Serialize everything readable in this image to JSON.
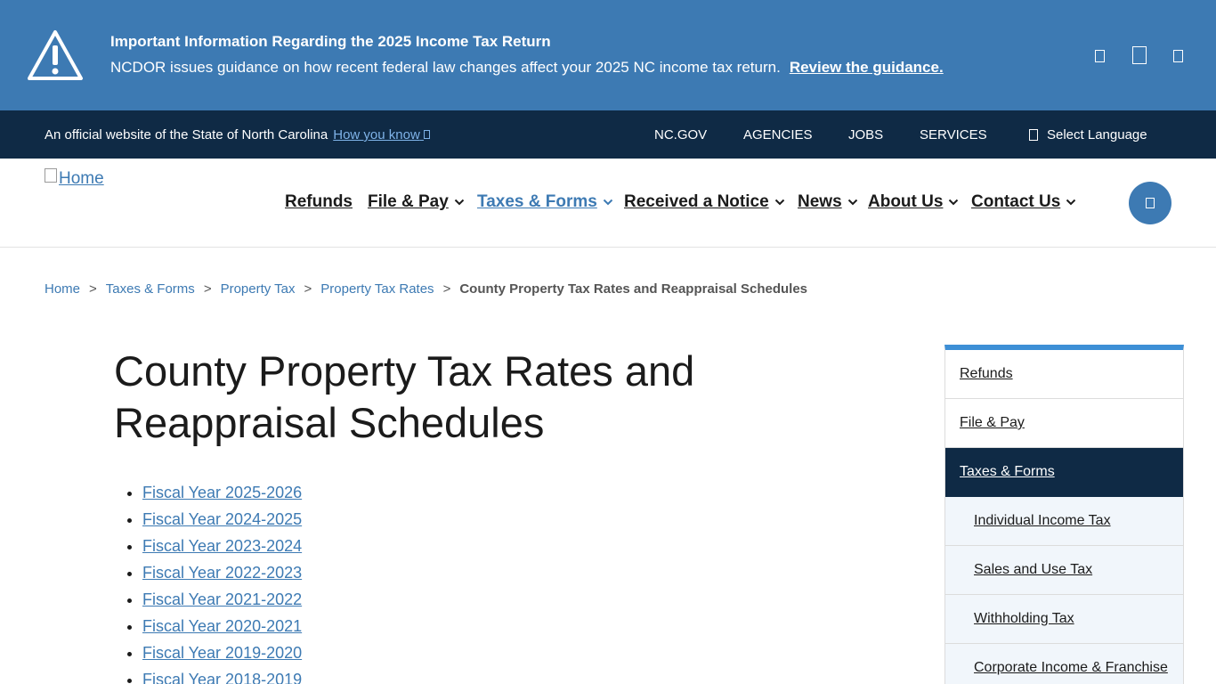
{
  "alert": {
    "title": "Important Information Regarding the 2025 Income Tax Return",
    "body": "NCDOR issues guidance on how recent federal law changes affect your 2025 NC income tax return.",
    "link": "Review the guidance.",
    "icon": "warning-triangle-icon",
    "controls": [
      "prev-icon",
      "pause-icon",
      "next-icon"
    ]
  },
  "official_bar": {
    "text": "An official website of the State of North Carolina",
    "how_link": "How you know",
    "utility_links": [
      "NC.GOV",
      "AGENCIES",
      "JOBS",
      "SERVICES"
    ],
    "language": "Select Language"
  },
  "header": {
    "logo_alt": "Home",
    "nav": [
      {
        "label": "Refunds",
        "dropdown": false,
        "active": false
      },
      {
        "label": "File & Pay",
        "dropdown": true,
        "active": false
      },
      {
        "label": "Taxes & Forms",
        "dropdown": true,
        "active": true
      },
      {
        "label": "Received a Notice",
        "dropdown": true,
        "active": false
      },
      {
        "label": "News",
        "dropdown": true,
        "active": false
      },
      {
        "label": "About Us",
        "dropdown": true,
        "active": false
      },
      {
        "label": "Contact Us",
        "dropdown": true,
        "active": false
      }
    ]
  },
  "breadcrumb": {
    "items": [
      "Home",
      "Taxes & Forms",
      "Property Tax",
      "Property Tax Rates"
    ],
    "separator": ">",
    "current": "County Property Tax Rates and Reappraisal Schedules"
  },
  "main": {
    "title": "County Property Tax Rates and Reappraisal Schedules",
    "fiscal_years": [
      "Fiscal Year 2025-2026",
      "Fiscal Year 2024-2025",
      "Fiscal Year 2023-2024",
      "Fiscal Year 2022-2023",
      "Fiscal Year 2021-2022",
      "Fiscal Year 2020-2021",
      "Fiscal Year 2019-2020",
      "Fiscal Year 2018-2019"
    ]
  },
  "sidenav": {
    "items": [
      {
        "label": "Refunds",
        "level": 1,
        "active": false
      },
      {
        "label": "File & Pay",
        "level": 1,
        "active": false
      },
      {
        "label": "Taxes & Forms",
        "level": 1,
        "active": true
      },
      {
        "label": "Individual Income Tax",
        "level": 2,
        "active": false
      },
      {
        "label": "Sales and Use Tax",
        "level": 2,
        "active": false
      },
      {
        "label": "Withholding Tax",
        "level": 2,
        "active": false
      },
      {
        "label": "Corporate Income & Franchise",
        "level": 2,
        "active": false
      }
    ]
  },
  "colors": {
    "alert_bg": "#3d7ab3",
    "official_bg": "#0f2a45",
    "link": "#3d7ab3",
    "sidenav_accent": "#3d8fd6"
  }
}
